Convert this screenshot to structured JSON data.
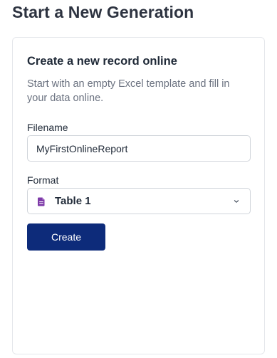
{
  "page": {
    "title": "Start a New Generation"
  },
  "card": {
    "title": "Create a new record online",
    "description": "Start with an empty Excel template and fill in your data online.",
    "filename": {
      "label": "Filename",
      "value": "MyFirstOnlineReport"
    },
    "format": {
      "label": "Format",
      "selected": "Table 1",
      "icon": "document-icon"
    },
    "create_label": "Create"
  },
  "colors": {
    "primary_button": "#0d2b7a",
    "format_icon": "#7e3aa8"
  }
}
